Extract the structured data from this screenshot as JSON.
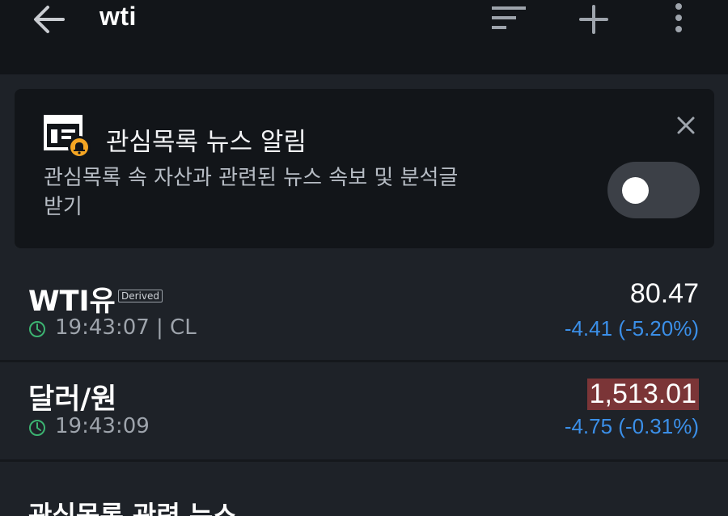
{
  "header": {
    "title": "wti",
    "icons": [
      "arrow-left-icon",
      "sort-icon",
      "plus-icon",
      "more-vert-icon"
    ]
  },
  "news_alert": {
    "title": "관심목록 뉴스 알림",
    "description": "관심목록 속 자산과 관련된 뉴스 속보 및 분석글 받기",
    "toggle_on": false,
    "icons": [
      "news-bell-icon",
      "close-icon"
    ]
  },
  "watchlist": [
    {
      "name": "WTI유",
      "badge": "Derived",
      "time": "19:43:07 | CL",
      "price": "80.47",
      "change": "-4.41 (-5.20%)",
      "highlight": false
    },
    {
      "name": "달러/원",
      "badge": "",
      "time": "19:43:09",
      "price": "1,513.01",
      "change": "-4.75 (-0.31%)",
      "highlight": true
    }
  ],
  "related_news": {
    "title": "관심목록 관련 뉴스"
  },
  "colors": {
    "background": "#1e2228",
    "header": "#121519",
    "negative_change": "#3b8fe8",
    "price_flash": "#7b3537",
    "clock_green": "#3cb371",
    "alert_orange": "#f5a623"
  }
}
